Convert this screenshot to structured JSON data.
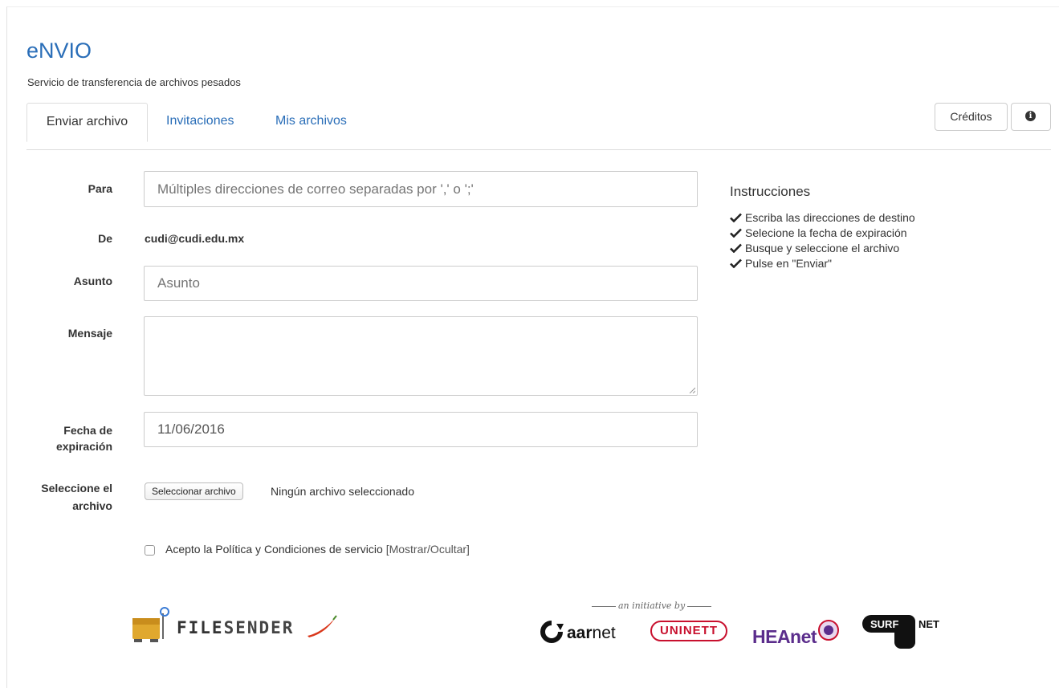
{
  "app": {
    "title": "eNVIO",
    "subtitle": "Servicio de transferencia de archivos pesados"
  },
  "nav": {
    "tabs": [
      {
        "label": "Enviar archivo",
        "active": true
      },
      {
        "label": "Invitaciones",
        "active": false
      },
      {
        "label": "Mis archivos",
        "active": false
      }
    ],
    "credits_label": "Créditos",
    "info_icon": "info-circle-icon"
  },
  "form": {
    "to_label": "Para",
    "to_placeholder": "Múltiples direcciones de correo separadas por ',' o ';'",
    "from_label": "De",
    "from_value": "cudi@cudi.edu.mx",
    "subject_label": "Asunto",
    "subject_placeholder": "Asunto",
    "message_label": "Mensaje",
    "message_value": "",
    "expiry_label_line1": "Fecha de",
    "expiry_label_line2": "expiración",
    "expiry_value": "11/06/2016",
    "file_label_line1": "Seleccione el",
    "file_label_line2": "archivo",
    "file_button": "Seleccionar archivo",
    "file_status": "Ningún archivo seleccionado",
    "terms_text": "Acepto la Política y Condiciones de servicio",
    "terms_toggle": "[Mostrar/Ocultar]",
    "terms_checked": false
  },
  "instructions": {
    "title": "Instrucciones",
    "items": [
      "Escriba las direcciones de destino",
      "Selecione la fecha de expiración",
      "Busque y seleccione el archivo",
      "Pulse en \"Enviar\""
    ]
  },
  "footer": {
    "filesender_prefix": "FILE",
    "filesender_suffix": "SENDER",
    "initiative": "an initiative by",
    "aarnet_prefix": "aar",
    "aarnet_suffix": "net",
    "uninett": "UNINETT",
    "heanet": "HEAnet",
    "surf": "SURF",
    "net": "NET"
  },
  "colors": {
    "link": "#2a6eb8",
    "uninett_red": "#c8102e",
    "heanet_purple": "#5b2d8c"
  }
}
